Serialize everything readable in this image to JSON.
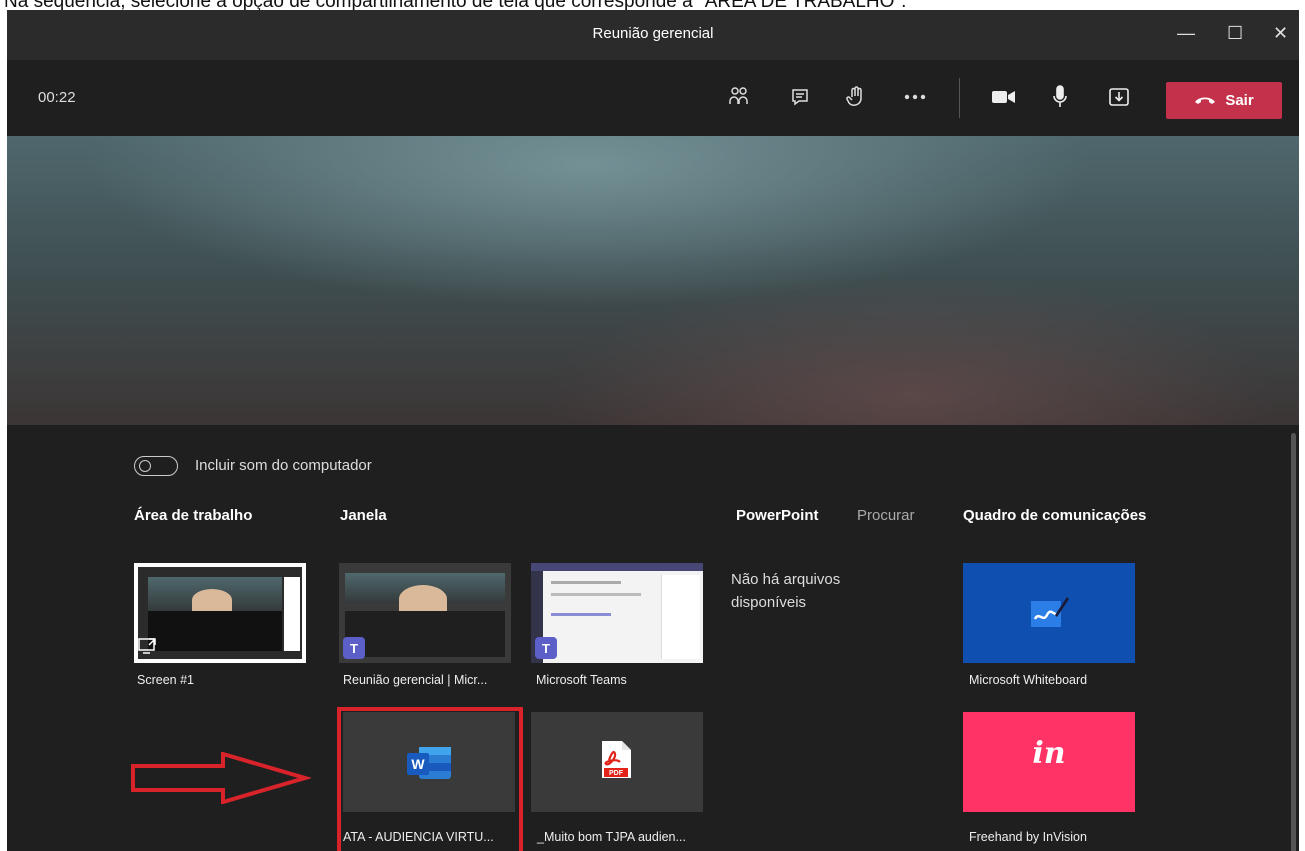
{
  "caption": "Na sequência, selecione a opção de compartilhamento de tela que corresponde à \"ÁREA DE TRABALHO\".",
  "window": {
    "title": "Reunião gerencial",
    "minimize": "—",
    "maximize": "☐",
    "close": "✕"
  },
  "toolbar": {
    "timer": "00:22",
    "leave_label": "Sair"
  },
  "panel": {
    "include_audio_label": "Incluir som do computador",
    "sections": {
      "desktop": "Área de trabalho",
      "window": "Janela",
      "powerpoint": "PowerPoint",
      "browse": "Procurar",
      "whiteboard": "Quadro de comunicações"
    },
    "no_files": "Não há arquivos disponíveis",
    "tiles": {
      "screen1": "Screen #1",
      "reuniao": "Reunião gerencial | Micr...",
      "teams": "Microsoft Teams",
      "ata": "ATA - AUDIENCIA VIRTU...",
      "pdf": "_Muito bom TJPA audien...",
      "ms_whiteboard": "Microsoft Whiteboard",
      "invision": "Freehand by InVision"
    },
    "word_glyph": "W",
    "pdf_glyph": "PDF",
    "invision_glyph": "in"
  },
  "colors": {
    "leave": "#c4314b",
    "highlight": "#d8232a",
    "whiteboard_bg": "#0f4fb0",
    "invision_bg": "#ff3366"
  }
}
